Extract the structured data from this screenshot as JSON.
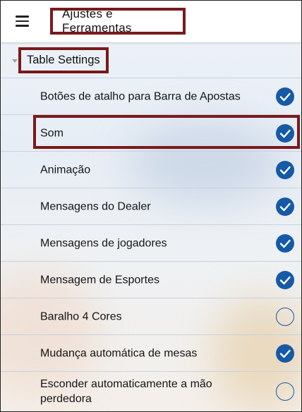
{
  "topbar": {
    "title": "Ajustes e Ferramentas",
    "menu_icon": "hamburger-menu-icon"
  },
  "section": {
    "title": "Table Settings",
    "arrow_icon": "collapse-arrow-icon"
  },
  "settings": [
    {
      "label": "Botões de atalho para Barra de Apostas",
      "checked": true
    },
    {
      "label": "Som",
      "checked": true
    },
    {
      "label": "Animação",
      "checked": true
    },
    {
      "label": "Mensagens do Dealer",
      "checked": true
    },
    {
      "label": "Mensagens de jogadores",
      "checked": true
    },
    {
      "label": "Mensagem de Esportes",
      "checked": true
    },
    {
      "label": "Baralho 4 Cores",
      "checked": false
    },
    {
      "label": "Mudança automática de mesas",
      "checked": true
    },
    {
      "label": "Esconder automaticamente a mão perdedora",
      "checked": false
    }
  ],
  "colors": {
    "accent": "#1659a7",
    "highlight_border": "#7a1a1a",
    "divider": "#c7d2de"
  }
}
